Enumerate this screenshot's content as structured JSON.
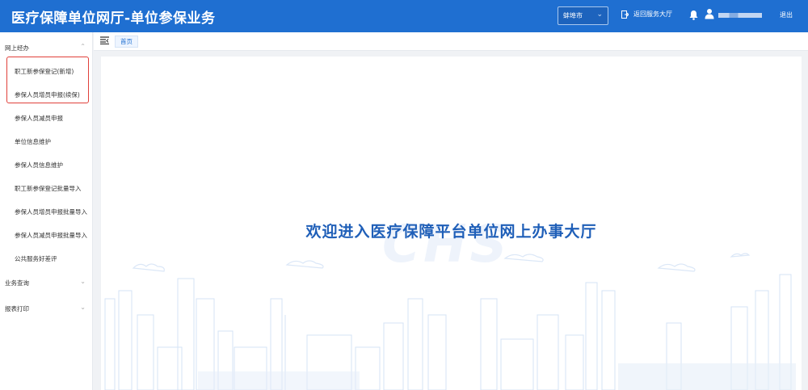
{
  "header": {
    "title": "医疗保障单位网厅-单位参保业务",
    "city": "蚌埠市",
    "back_label": "返回服务大厅",
    "logout_label": "退出"
  },
  "sidebar": {
    "groups": [
      {
        "label": "网上经办"
      },
      {
        "label": "业务查询"
      },
      {
        "label": "报表打印"
      }
    ],
    "items": [
      {
        "label": "职工新参保登记(新增)"
      },
      {
        "label": "参保人员增员申报(续保)"
      },
      {
        "label": "参保人员减员申报"
      },
      {
        "label": "单位信息维护"
      },
      {
        "label": "参保人员信息维护"
      },
      {
        "label": "职工新参保登记批量导入"
      },
      {
        "label": "参保人员增员申报批量导入"
      },
      {
        "label": "参保人员减员申报批量导入"
      },
      {
        "label": "公共服务好差评"
      }
    ]
  },
  "tabs": [
    {
      "label": "首页"
    }
  ],
  "main": {
    "welcome": "欢迎进入医疗保障平台单位网上办事大厅",
    "watermark": "CHS"
  },
  "colors": {
    "header": "#1f6fd1",
    "highlight": "#e0403a",
    "accent": "#1f5fb8"
  }
}
